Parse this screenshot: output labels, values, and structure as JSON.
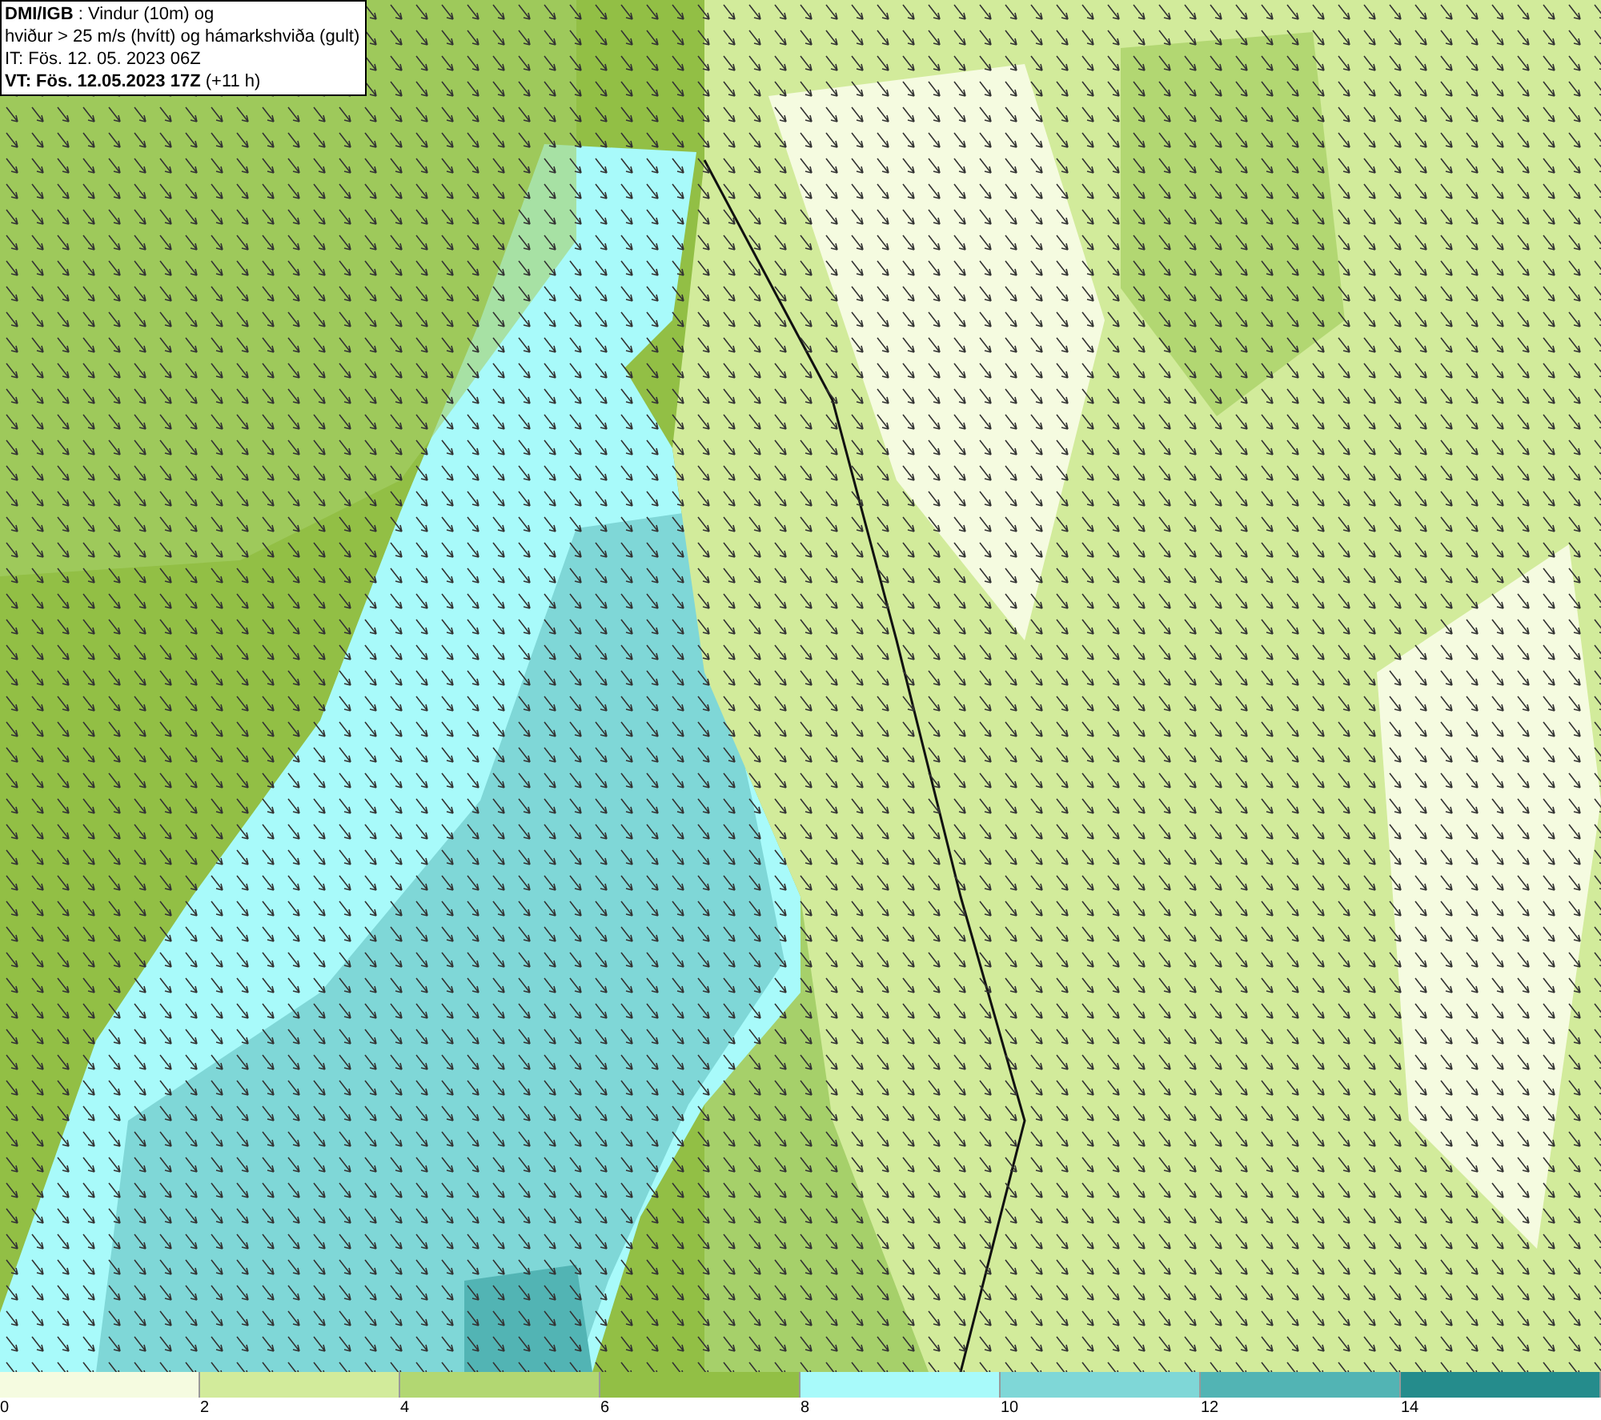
{
  "info_box": {
    "lines": [
      "**DMI/IGB** : Vindur (10m) og",
      "hviður > 25 m/s (hvítt) og hámarkshviða (gult)",
      "IT: Fös. 12. 05. 2023 06Z",
      "**VT: Fös. 12.05.2023 17Z** (+11 h)"
    ]
  },
  "legend": {
    "bins": [
      {
        "color": "#f5fbe0"
      },
      {
        "color": "#d2eb9b"
      },
      {
        "color": "#b2d772"
      },
      {
        "color": "#92bf45"
      },
      {
        "color": "#a8fafa"
      },
      {
        "color": "#7fd7d7"
      },
      {
        "color": "#52b4b4"
      },
      {
        "color": "#258c8c"
      }
    ],
    "ticks": [
      "0",
      "2",
      "4",
      "6",
      "8",
      "10",
      "12",
      "14"
    ]
  }
}
